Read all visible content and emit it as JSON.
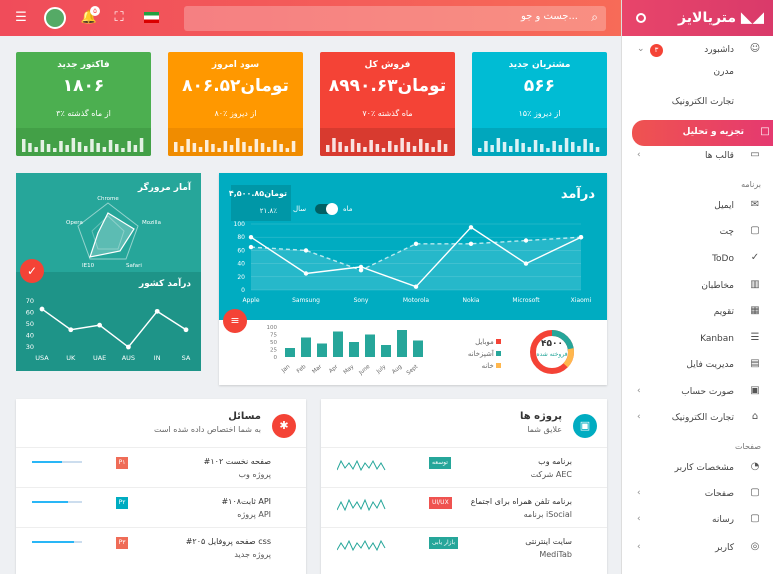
{
  "topbar": {
    "search_placeholder": "جست و جو...",
    "notif_count": "۵"
  },
  "brand": {
    "name": "متریالایز"
  },
  "sidebar": {
    "items": [
      {
        "label": "داشبورد",
        "badge": "۳"
      },
      {
        "label": "مدرن"
      },
      {
        "label": "تجارت الکترونیک"
      },
      {
        "label": "تجزیه و تحلیل"
      },
      {
        "label": "قالب ها"
      },
      {
        "label": "ایمیل"
      },
      {
        "label": "چت"
      },
      {
        "label": "ToDo"
      },
      {
        "label": "مخاطبان"
      },
      {
        "label": "تقویم"
      },
      {
        "label": "Kanban"
      },
      {
        "label": "مدیریت فایل"
      },
      {
        "label": "صورت حساب"
      },
      {
        "label": "تجارت الکترونیک"
      },
      {
        "label": "مشخصات کاربر"
      },
      {
        "label": "صفحات"
      },
      {
        "label": "رسانه"
      },
      {
        "label": "کاربر"
      }
    ],
    "sections": {
      "apps": "برنامه",
      "pages": "صفحات"
    }
  },
  "cards": [
    {
      "title": "مشتریان جدید",
      "value": "۵۶۶",
      "change": "۱۵٪ از دیروز",
      "color": "#00bcd4"
    },
    {
      "title": "فروش کل",
      "value": "تومان۸۹۹۰.۶۳",
      "change": "۷۰٪ ماه گذشته",
      "color": "#f44336"
    },
    {
      "title": "سود امروز",
      "value": "تومان۸۰۶.۵۲",
      "change": "۸۰٪ از دیروز",
      "color": "#ff9800"
    },
    {
      "title": "فاکتور جدید",
      "value": "۱۸۰۶",
      "change": "۳٪ از ماه گذشته",
      "color": "#4caf50"
    }
  ],
  "revenue": {
    "title": "درآمد",
    "total_label": "تومان۴,۵۰۰.۸۵",
    "total_change": "۲۱.۸٪",
    "toggle_month": "ماه",
    "toggle_year": "سال",
    "legend": [
      "موبایل",
      "آشپزخانه",
      "خانه"
    ],
    "donut_value": "۴۵۰۰",
    "donut_label": "فروخته شده"
  },
  "traffic": {
    "title": "آمار مرورگر",
    "labels": [
      "Chrome",
      "Mozilla",
      "Safari",
      "IE10",
      "Opera"
    ]
  },
  "country": {
    "title": "درآمد کشور"
  },
  "issues": {
    "title": "مسائل",
    "subtitle": "به شما اختصاص داده شده است",
    "rows": [
      {
        "title": "#۱۰۲ صفحه نخست",
        "sub": "پروژه وب",
        "tag": "P۱"
      },
      {
        "title": "#۱۰۸ثابت API",
        "sub": "پروژه API",
        "tag": "P۲"
      },
      {
        "title": "#۲۰۵ صفحه پروفایل css",
        "sub": "پروژه جدید",
        "tag": "P۳"
      }
    ]
  },
  "projects": {
    "title": "پروژه ها",
    "subtitle": "علایق شما",
    "rows": [
      {
        "title": "برنامه وب",
        "sub": "شرکت AEC",
        "tag": "توسعه"
      },
      {
        "title": "برنامه تلفن همراه برای اجتماع",
        "sub": "برنامه iSocial",
        "tag": "UI/UX"
      },
      {
        "title": "سایت اینترنتی",
        "sub": "MediTab",
        "tag": "بازار یابی"
      }
    ]
  },
  "chart_data": [
    {
      "type": "line",
      "title": "درآمد",
      "categories": [
        "Apple",
        "Samsung",
        "Sony",
        "Motorola",
        "Nokia",
        "Microsoft",
        "Xiaomi"
      ],
      "series": [
        {
          "values": [
            80,
            25,
            35,
            5,
            95,
            40,
            80
          ]
        },
        {
          "values": [
            65,
            60,
            30,
            70,
            70,
            75,
            80
          ]
        }
      ],
      "ylim": [
        0,
        100
      ],
      "yticks": [
        0,
        20,
        40,
        60,
        80,
        100
      ]
    },
    {
      "type": "bar",
      "categories": [
        "Jan",
        "Feb",
        "Mar",
        "Apr",
        "May",
        "June",
        "July",
        "Aug",
        "Sept"
      ],
      "series": [
        {
          "values": [
            30,
            65,
            45,
            85,
            50,
            75,
            40,
            90,
            55
          ]
        }
      ],
      "ylim": [
        0,
        100
      ],
      "yticks": [
        0,
        25,
        50,
        75,
        100
      ]
    },
    {
      "type": "line",
      "title": "درآمد کشور",
      "categories": [
        "USA",
        "UK",
        "UAE",
        "AUS",
        "IN",
        "SA"
      ],
      "series": [
        {
          "values": [
            63,
            45,
            49,
            30,
            61,
            45
          ]
        }
      ],
      "ylim": [
        30,
        70
      ],
      "yticks": [
        30,
        40,
        50,
        60,
        70
      ]
    }
  ]
}
